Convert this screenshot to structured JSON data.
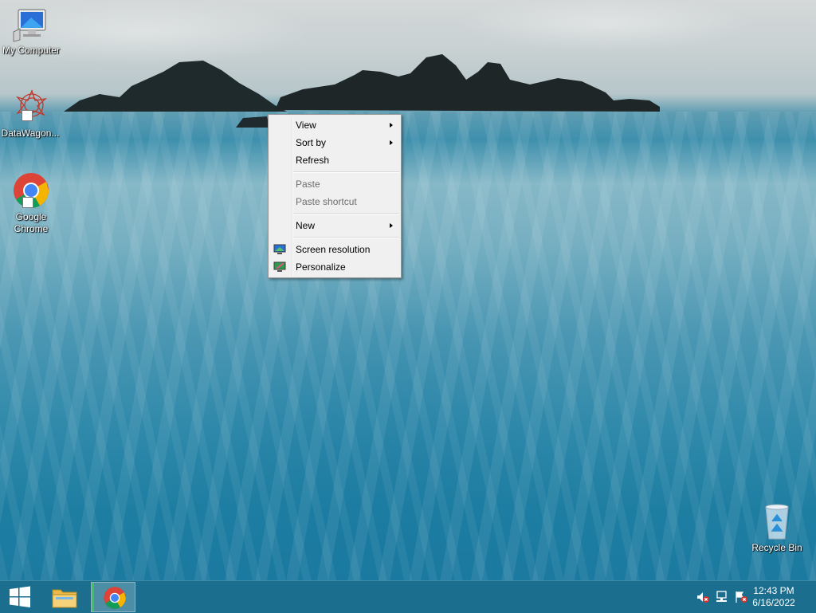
{
  "desktop": {
    "icons": {
      "my_computer": "My Computer",
      "datawagon": "DataWagon...",
      "chrome_line1": "Google",
      "chrome_line2": "Chrome",
      "recycle_bin": "Recycle Bin"
    }
  },
  "context_menu": {
    "view": "View",
    "sort_by": "Sort by",
    "refresh": "Refresh",
    "paste": "Paste",
    "paste_shortcut": "Paste shortcut",
    "new": "New",
    "screen_resolution": "Screen resolution",
    "personalize": "Personalize"
  },
  "taskbar": {
    "clock": {
      "time": "12:43 PM",
      "date": "6/16/2022"
    }
  },
  "colors": {
    "taskbar": "#1b6e8e",
    "menu_bg": "#f0f0f0",
    "chrome_red": "#db4437",
    "chrome_green": "#0f9d58",
    "chrome_yellow": "#f4b400",
    "chrome_blue": "#4285f4"
  }
}
